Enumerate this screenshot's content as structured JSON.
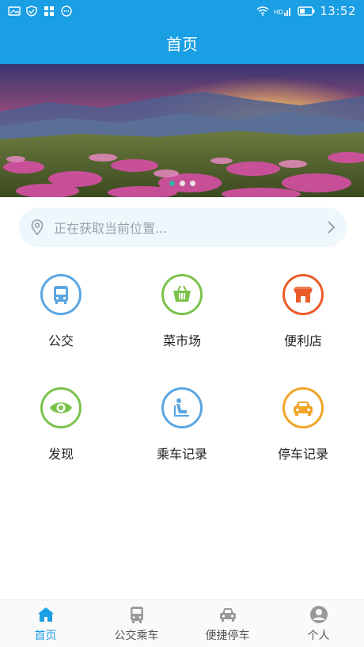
{
  "status_bar": {
    "left_icons": [
      "image-icon",
      "shield-icon",
      "apps-icon",
      "chat-icon"
    ],
    "right_icons": [
      "wifi-icon",
      "hd-signal-icon",
      "battery-icon"
    ],
    "time": "13:52"
  },
  "header": {
    "title": "首页"
  },
  "banner": {
    "slides": 3,
    "active_index": 0,
    "colors": {
      "active_dot": "#2bb3a0",
      "dot": "#e6e6e6"
    }
  },
  "location": {
    "text": "正在获取当前位置..."
  },
  "services": [
    {
      "label": "公交",
      "icon": "bus-icon",
      "color": "#5aa6e3"
    },
    {
      "label": "菜市场",
      "icon": "basket-icon",
      "color": "#7bc24d"
    },
    {
      "label": "便利店",
      "icon": "store-icon",
      "color": "#ec5b2a"
    },
    {
      "label": "发现",
      "icon": "eye-icon",
      "color": "#7bc24d"
    },
    {
      "label": "乘车记录",
      "icon": "seat-icon",
      "color": "#5aa6e3"
    },
    {
      "label": "停车记录",
      "icon": "car-icon",
      "color": "#f2a428"
    }
  ],
  "bottom_nav": [
    {
      "label": "首页",
      "icon": "home-icon",
      "active": true
    },
    {
      "label": "公交乘车",
      "icon": "bus-icon",
      "active": false
    },
    {
      "label": "便捷停车",
      "icon": "car-icon",
      "active": false
    },
    {
      "label": "个人",
      "icon": "user-icon",
      "active": false
    }
  ],
  "colors": {
    "primary": "#1a9ee4",
    "location_bg": "#eef7fb",
    "nav_inactive": "#555555"
  }
}
